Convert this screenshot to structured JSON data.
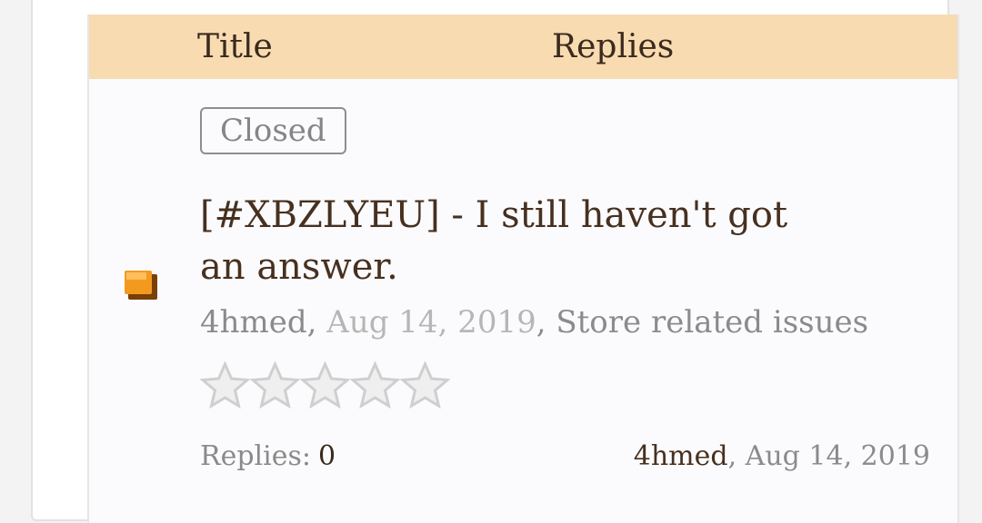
{
  "table": {
    "headers": {
      "title": "Title",
      "replies": "Replies"
    }
  },
  "thread": {
    "status_badge": "Closed",
    "title": "[#XBZLYEU] - I still haven't got an answer.",
    "author": "4hmed",
    "date": "Aug 14, 2019",
    "forum": "Store related issues",
    "rating_stars": 0,
    "rating_max": 5,
    "replies_label": "Replies:",
    "replies_count": "0",
    "last_post_user": "4hmed",
    "last_post_date": "Aug 14, 2019"
  },
  "icons": {
    "status": "closed-flag-icon",
    "star": "star-empty-icon"
  },
  "colors": {
    "header_bg": "#f8dbb0",
    "flag": "#f39a1e",
    "text_dark": "#47301f"
  }
}
